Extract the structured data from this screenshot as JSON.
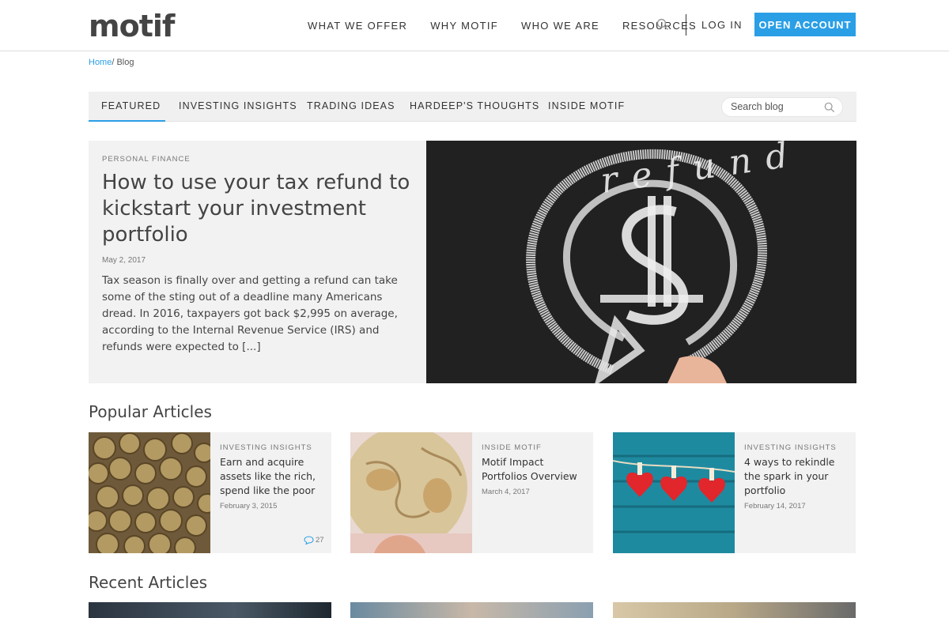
{
  "header": {
    "logo": "motif",
    "nav": [
      "WHAT WE OFFER",
      "WHY MOTIF",
      "WHO WE ARE",
      "RESOURCES"
    ],
    "search_icon": "search-icon",
    "login": "LOG IN",
    "open_account": "OPEN ACCOUNT"
  },
  "breadcrumb": {
    "home": "Home",
    "separator": "/ ",
    "current": "Blog"
  },
  "categories": {
    "tabs": [
      "FEATURED",
      "INVESTING INSIGHTS",
      "TRADING IDEAS",
      "HARDEEP'S THOUGHTS",
      "INSIDE MOTIF"
    ],
    "active": "FEATURED",
    "search_placeholder": "Search blog"
  },
  "featured": {
    "category": "PERSONAL FINANCE",
    "title": "How to use your tax refund to kickstart your investment portfolio",
    "date": "May 2, 2017",
    "excerpt": "Tax season is finally over and getting a refund can take some of the sting out of a deadline many Americans dread. In 2016, taxpayers got back $2,995 on average, according to the Internal Revenue Service (IRS) and refunds were expected to [...]",
    "image_text": "refund"
  },
  "popular": {
    "title": "Popular Articles",
    "articles": [
      {
        "category": "INVESTING INSIGHTS",
        "title": "Earn and acquire assets like the rich, spend like the poor",
        "date": "February 3, 2015",
        "comments": "27"
      },
      {
        "category": "INSIDE MOTIF",
        "title": "Motif Impact Portfolios Overview",
        "date": "March 4, 2017"
      },
      {
        "category": "INVESTING INSIGHTS",
        "title": "4 ways to rekindle the spark in your portfolio",
        "date": "February 14, 2017"
      }
    ]
  },
  "recent": {
    "title": "Recent Articles"
  },
  "colors": {
    "accent": "#2a9fe6",
    "panel": "#f2f2f2",
    "text": "#444444"
  }
}
